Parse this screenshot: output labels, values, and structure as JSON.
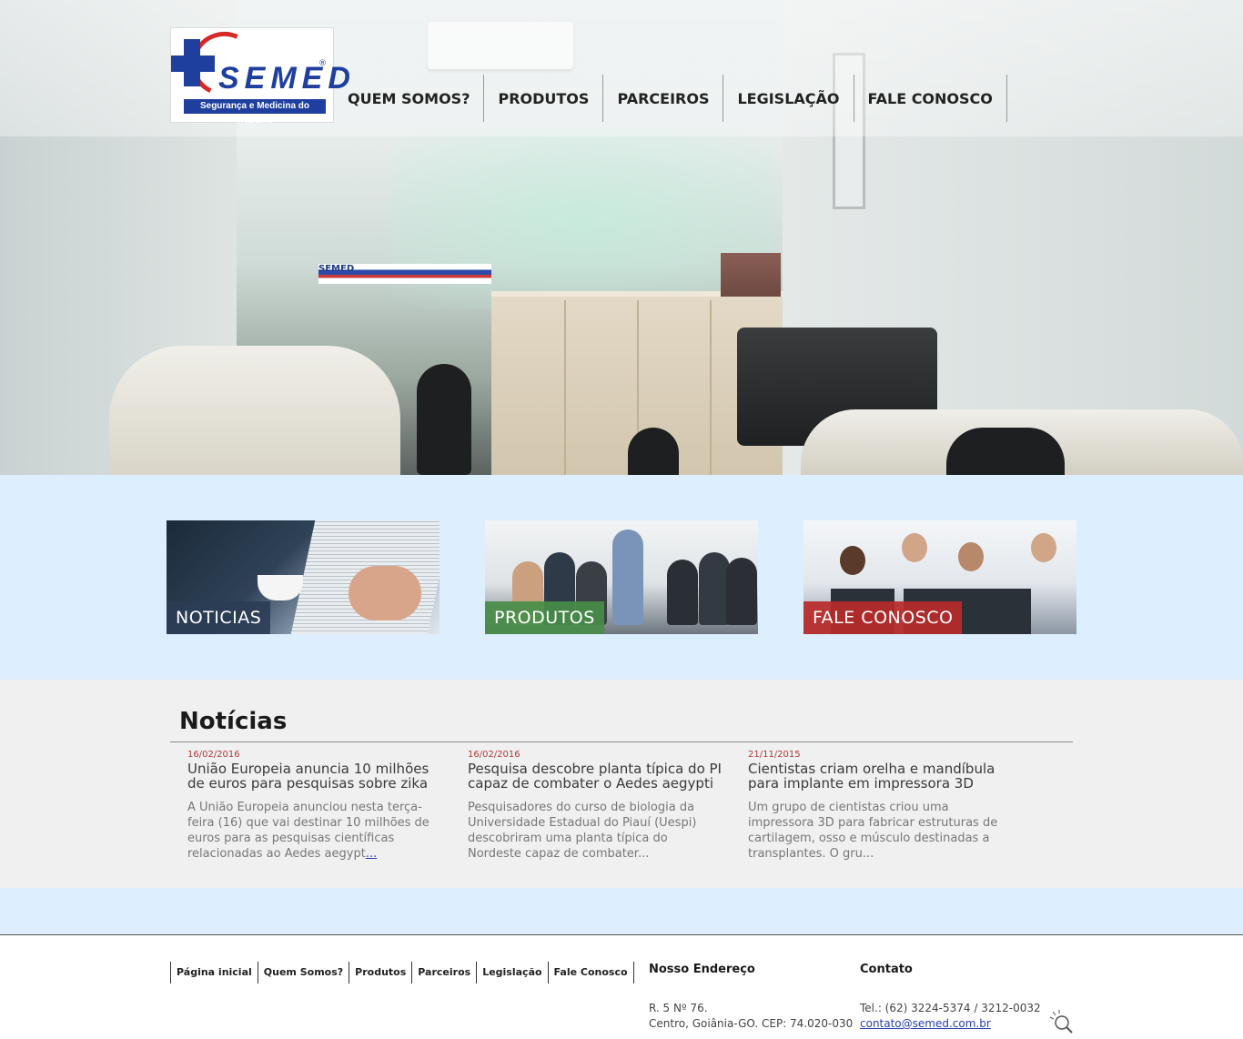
{
  "header": {
    "logo": {
      "brand": "SEMED",
      "registered": "®",
      "tagline": "Segurança e Medicina do Trabalho"
    },
    "nav": [
      {
        "label": "QUEM SOMOS?"
      },
      {
        "label": "PRODUTOS"
      },
      {
        "label": "PARCEIROS"
      },
      {
        "label": "LEGISLAÇÃO"
      },
      {
        "label": "FALE CONOSCO"
      }
    ],
    "hero_sign": "SEMED"
  },
  "features": [
    {
      "label": "NOTICIAS",
      "color": "#2b3c55"
    },
    {
      "label": "PRODUTOS",
      "color": "#488c48"
    },
    {
      "label": "FALE CONOSCO",
      "color": "#ba2a2a"
    }
  ],
  "news": {
    "title": "Notícias",
    "items": [
      {
        "date": "16/02/2016",
        "headline": "União Europeia anuncia 10 milhões de euros para pesquisas sobre zika",
        "excerpt": "A União Europeia anunciou nesta terça-feira (16) que vai destinar 10 milhões de euros para as pesquisas científicas relacionadas ao Aedes aegypt",
        "more": "..."
      },
      {
        "date": "16/02/2016",
        "headline": "Pesquisa descobre planta típica do PI capaz de combater o Aedes aegypti",
        "excerpt": "  Pesquisadores do curso de biologia da Universidade Estadual do Piauí (Uespi) descobriram uma planta típica do Nordeste capaz de combater",
        "more": "..."
      },
      {
        "date": "21/11/2015",
        "headline": "Cientistas criam orelha e mandíbula para implante em impressora 3D",
        "excerpt": "  Um grupo de cientistas criou uma impressora 3D para fabricar estruturas de cartilagem, osso e músculo destinadas a transplantes. O gru",
        "more": "..."
      }
    ]
  },
  "footer": {
    "nav": [
      {
        "label": "Página inicial"
      },
      {
        "label": "Quem Somos?"
      },
      {
        "label": "Produtos"
      },
      {
        "label": "Parceiros"
      },
      {
        "label": "Legislação"
      },
      {
        "label": "Fale Conosco"
      }
    ],
    "address": {
      "title": "Nosso Endereço",
      "line1": "R. 5 Nº 76.",
      "line2": "Centro, Goiânia-GO. CEP: 74.020-030"
    },
    "contact": {
      "title": "Contato",
      "phone": "Tel.: (62) 3224-5374 / 3212-0032",
      "email": "contato@semed.com.br"
    },
    "search_icon": "search-icon"
  }
}
